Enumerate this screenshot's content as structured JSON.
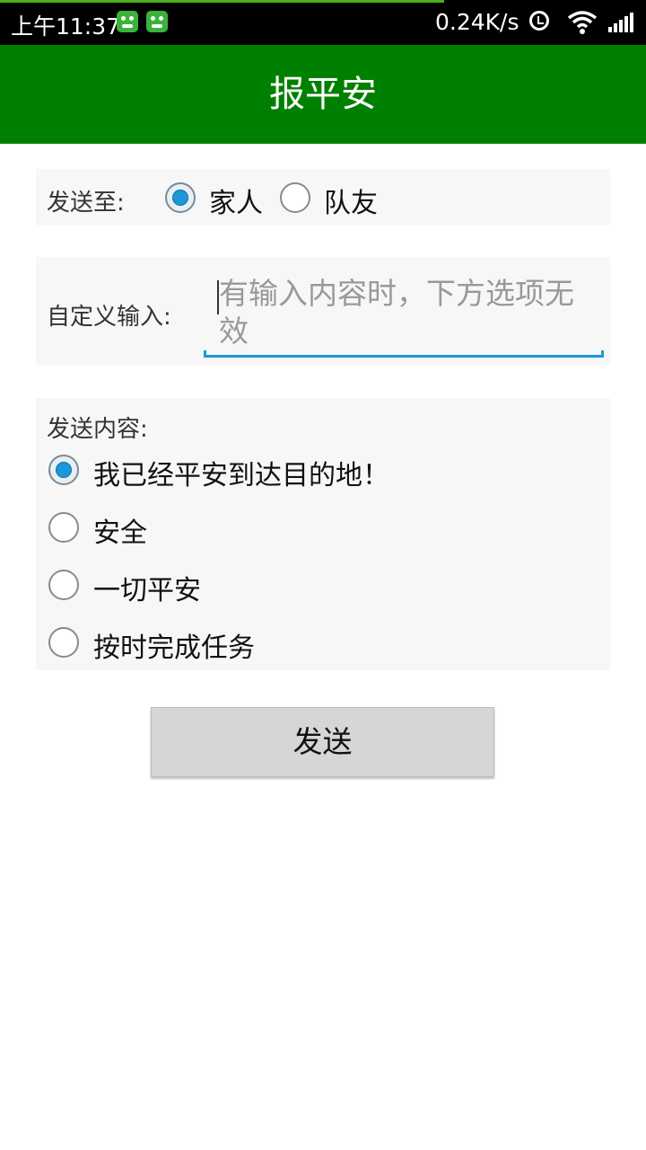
{
  "status_bar": {
    "time": "上午11:37",
    "net_speed": "0.24K/s",
    "icons": [
      "notification-app-icon",
      "notification-app-icon",
      "alarm-icon",
      "wifi-icon",
      "signal-icon"
    ]
  },
  "app_bar": {
    "title": "报平安"
  },
  "recipient": {
    "label": "发送至:",
    "options": [
      {
        "label": "家人",
        "checked": true
      },
      {
        "label": "队友",
        "checked": false
      }
    ]
  },
  "custom_input": {
    "label": "自定义输入:",
    "value": "",
    "placeholder": "有输入内容时，下方选项无效"
  },
  "content": {
    "label": "发送内容:",
    "options": [
      {
        "label": "我已经平安到达目的地！",
        "checked": true
      },
      {
        "label": "安全",
        "checked": false
      },
      {
        "label": "一切平安",
        "checked": false
      },
      {
        "label": "按时完成任务",
        "checked": false
      }
    ]
  },
  "send_button": {
    "label": "发送"
  },
  "colors": {
    "app_bar": "#008000",
    "accent": "#1c98d8",
    "panel_bg": "#f7f7f7",
    "button_bg": "#d6d6d6"
  }
}
